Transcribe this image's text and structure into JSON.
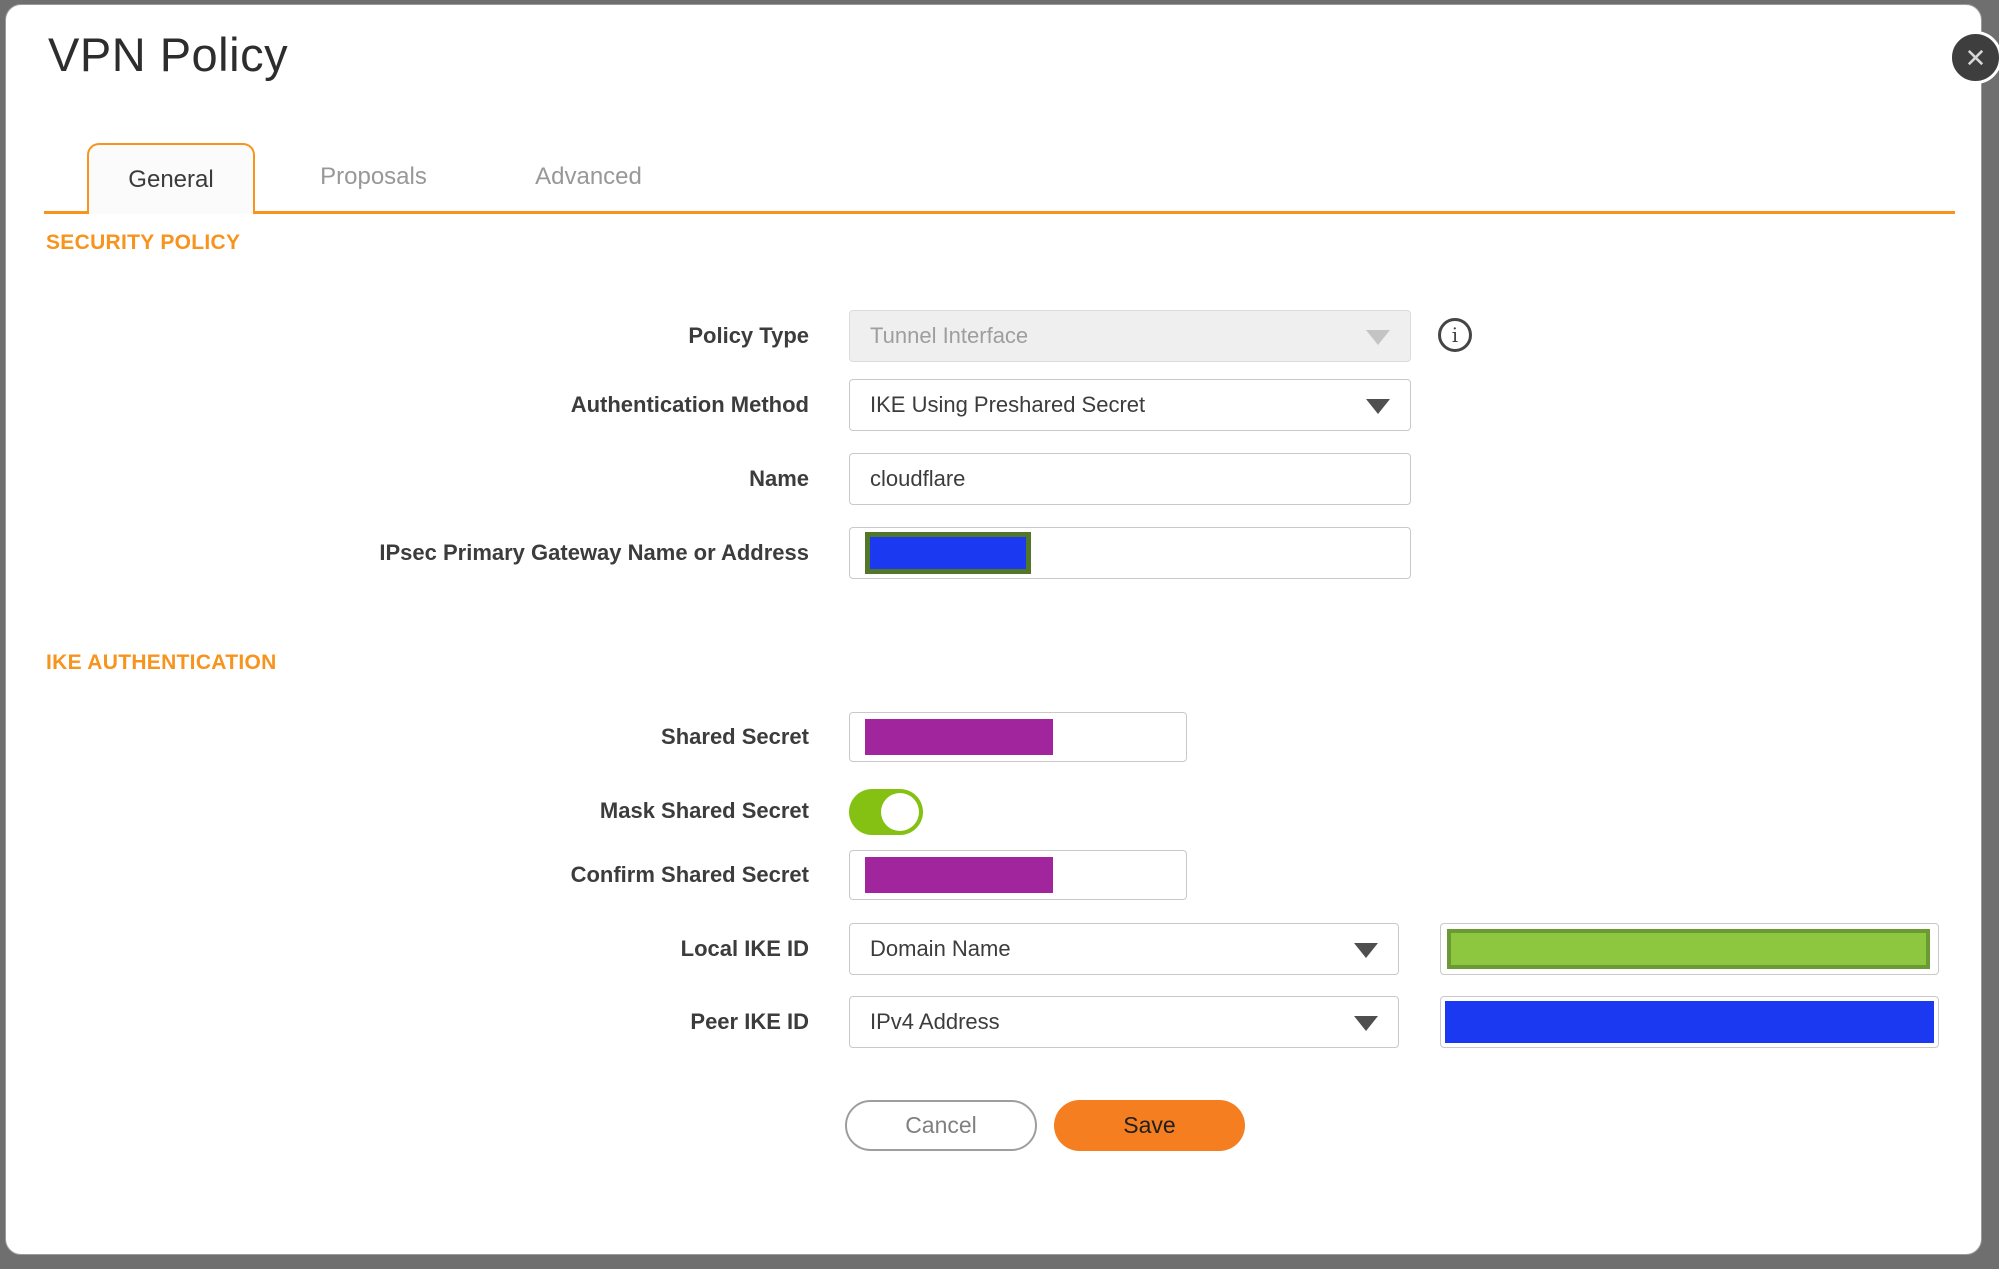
{
  "colors": {
    "accent_orange": "#F7941E",
    "save_orange": "#F57E20",
    "toggle_green": "#84C112",
    "redaction_purple": "#A1259C",
    "redaction_blue": "#1C39F2",
    "redaction_green": "#8DC63F",
    "redaction_green_border": "#6B9A34",
    "redaction_olive_border": "#52762A"
  },
  "dialog": {
    "title": "VPN Policy"
  },
  "icons": {
    "close": "✕",
    "info": "i"
  },
  "tabs": {
    "general": "General",
    "proposals": "Proposals",
    "advanced": "Advanced"
  },
  "sections": {
    "security_policy": "SECURITY POLICY",
    "ike_authentication": "IKE AUTHENTICATION"
  },
  "security": {
    "policy_type": {
      "label": "Policy Type",
      "value": "Tunnel Interface",
      "disabled": true
    },
    "auth_method": {
      "label": "Authentication Method",
      "value": "IKE Using Preshared Secret"
    },
    "name": {
      "label": "Name",
      "value": "cloudflare"
    },
    "gateway": {
      "label": "IPsec Primary Gateway Name or Address",
      "value_state": "redacted"
    }
  },
  "ike": {
    "shared_secret": {
      "label": "Shared Secret",
      "value_state": "redacted"
    },
    "mask_shared_secret": {
      "label": "Mask Shared Secret",
      "state": "on"
    },
    "confirm_shared_secret": {
      "label": "Confirm Shared Secret",
      "value_state": "redacted"
    },
    "local_ike_id": {
      "label": "Local IKE ID",
      "value": "Domain Name",
      "id_value_state": "redacted"
    },
    "peer_ike_id": {
      "label": "Peer IKE ID",
      "value": "IPv4 Address",
      "id_value_state": "redacted"
    }
  },
  "buttons": {
    "cancel": "Cancel",
    "save": "Save"
  }
}
